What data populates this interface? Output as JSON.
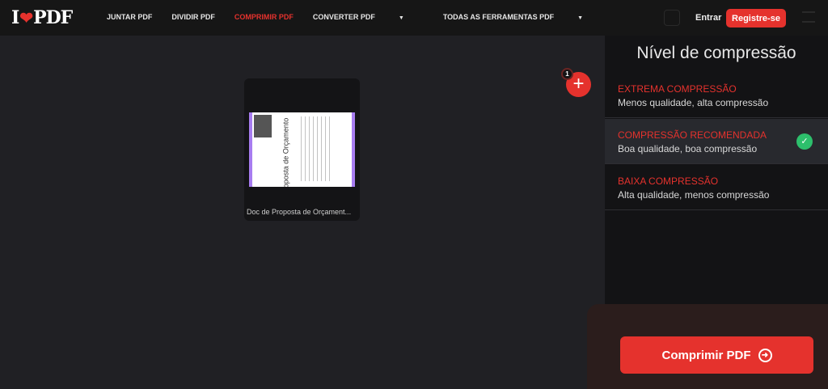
{
  "header": {
    "logo": "I❤PDF",
    "logo_left": "I",
    "logo_right": "PDF",
    "nav": [
      {
        "label": "JUNTAR PDF"
      },
      {
        "label": "DIVIDIR PDF"
      },
      {
        "label": "COMPRIMIR PDF",
        "active": true
      },
      {
        "label": "CONVERTER PDF"
      },
      {
        "label": "TODAS AS FERRAMENTAS PDF"
      }
    ],
    "login": "Entrar",
    "register": "Registre-se"
  },
  "file": {
    "name": "Doc de Proposta de Orçament...",
    "thumb_title": "Proposta de Orçamento",
    "count": "1"
  },
  "panel": {
    "title": "Nível de compressão",
    "options": [
      {
        "title": "EXTREMA COMPRESSÃO",
        "desc": "Menos qualidade, alta compressão"
      },
      {
        "title": "COMPRESSÃO RECOMENDADA",
        "desc": "Boa qualidade, boa compressão",
        "selected": true
      },
      {
        "title": "BAIXA COMPRESSÃO",
        "desc": "Alta qualidade, menos compressão"
      }
    ],
    "action": "Comprimir PDF"
  },
  "colors": {
    "accent": "#e5322d",
    "check": "#2dbf6c"
  }
}
